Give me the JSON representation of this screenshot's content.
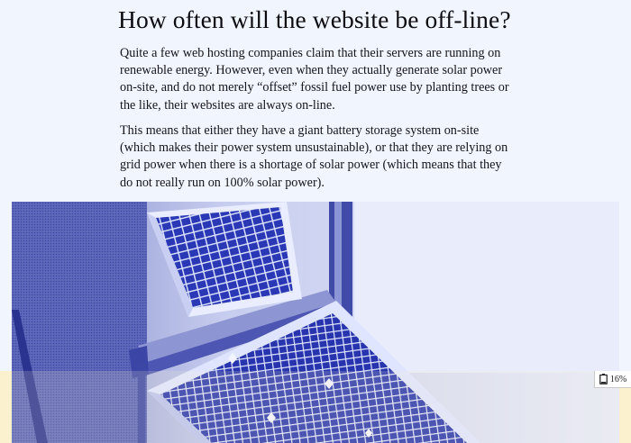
{
  "article": {
    "title": "How often will the website be off-line?",
    "paragraphs": [
      "Quite a few web hosting companies claim that their servers are running on renewable energy. However, even when they actually generate solar power on-site, and do not merely “offset” fossil fuel power use by planting trees or the like, their websites are always on-line.",
      "This means that either they have a giant battery storage system on-site (which makes their power system unsustainable), or that they are relying on grid power when there is a shortage of solar power (which means that they do not really run on 100% solar power)."
    ]
  },
  "battery_indicator": {
    "icon": "battery-icon",
    "label": "16%",
    "level": 0.16
  },
  "colors": {
    "page_background": "#f1f5fd",
    "lower_background": "#fbf1cf",
    "image_tint": "#2c3aa8"
  }
}
